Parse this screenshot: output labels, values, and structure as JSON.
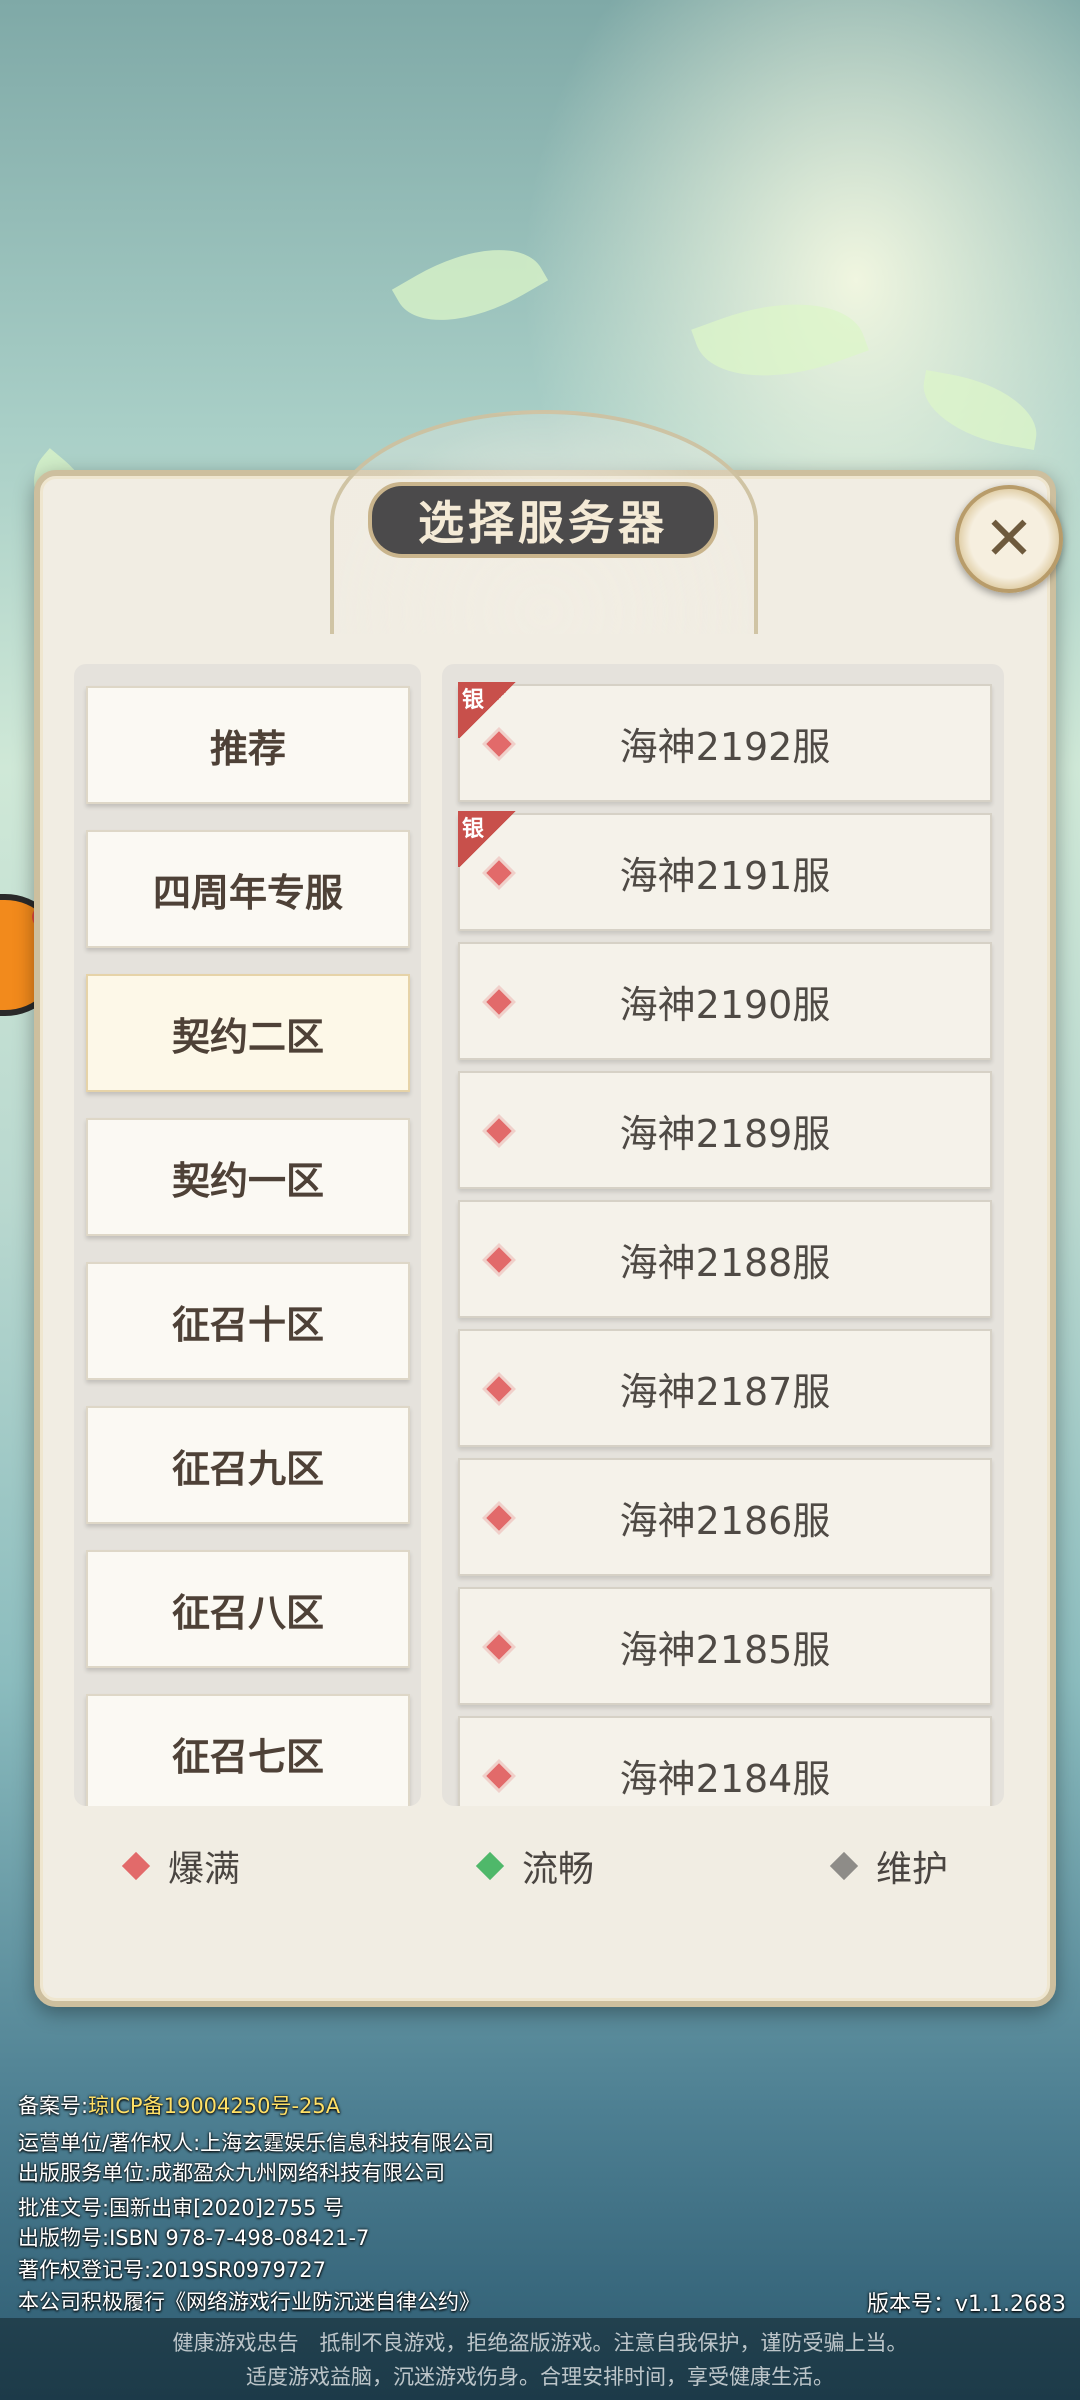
{
  "dialog": {
    "title": "选择服务器",
    "close_icon": "close-x-icon"
  },
  "categories": [
    {
      "label": "推荐",
      "active": false
    },
    {
      "label": "四周年专服",
      "active": false
    },
    {
      "label": "契约二区",
      "active": true
    },
    {
      "label": "契约一区",
      "active": false
    },
    {
      "label": "征召十区",
      "active": false
    },
    {
      "label": "征召九区",
      "active": false
    },
    {
      "label": "征召八区",
      "active": false
    },
    {
      "label": "征召七区",
      "active": false
    }
  ],
  "servers": [
    {
      "name": "海神2192服",
      "status": "full",
      "tag": "银"
    },
    {
      "name": "海神2191服",
      "status": "full",
      "tag": "银"
    },
    {
      "name": "海神2190服",
      "status": "full",
      "tag": ""
    },
    {
      "name": "海神2189服",
      "status": "full",
      "tag": ""
    },
    {
      "name": "海神2188服",
      "status": "full",
      "tag": ""
    },
    {
      "name": "海神2187服",
      "status": "full",
      "tag": ""
    },
    {
      "name": "海神2186服",
      "status": "full",
      "tag": ""
    },
    {
      "name": "海神2185服",
      "status": "full",
      "tag": ""
    },
    {
      "name": "海神2184服",
      "status": "full",
      "tag": ""
    }
  ],
  "legend": [
    {
      "label": "爆满",
      "color": "#e26a6a"
    },
    {
      "label": "流畅",
      "color": "#4fb86a"
    },
    {
      "label": "维护",
      "color": "#8e8c88"
    }
  ],
  "info": {
    "record_label": "备案号:",
    "record_value": "琼ICP备19004250号-25A",
    "operator": "运营单位/著作权人:上海玄霆娱乐信息科技有限公司",
    "publisher": "出版服务单位:成都盈众九州网络科技有限公司",
    "approval": "批准文号:国新出审[2020]2755 号",
    "isbn": "出版物号:ISBN 978-7-498-08421-7",
    "copyright": "著作权登记号:2019SR0979727",
    "pledge": "本公司积极履行《网络游戏行业防沉迷自律公约》",
    "version": "版本号：v1.1.2683"
  },
  "footer": {
    "line1": "健康游戏忠告　抵制不良游戏，拒绝盗版游戏。注意自我保护，谨防受骗上当。",
    "line2": "适度游戏益脑，沉迷游戏伤身。合理安排时间，享受健康生活。"
  }
}
